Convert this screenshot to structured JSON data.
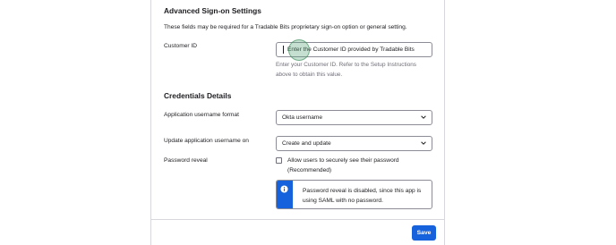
{
  "advanced": {
    "title": "Advanced Sign-on Settings",
    "description": "These fields may be required for a Tradable Bits proprietary sign-on option or general setting.",
    "customer_id": {
      "label": "Customer ID",
      "value": "",
      "placeholder": "Enter the Customer ID provided by Tradable Bits",
      "help": "Enter your Customer ID. Refer to the Setup Instructions above to obtain this value."
    }
  },
  "credentials": {
    "title": "Credentials Details",
    "username_format": {
      "label": "Application username format",
      "value": "Okta username"
    },
    "update_username": {
      "label": "Update application username on",
      "value": "Create and update"
    },
    "password_reveal": {
      "label": "Password reveal",
      "checkbox_label": "Allow users to securely see their password (Recommended)",
      "checked": false,
      "info": "Password reveal is disabled, since this app is using SAML with no password."
    }
  },
  "footer": {
    "save_label": "Save"
  },
  "colors": {
    "accent": "#1662dd"
  },
  "icons": {
    "dropdown": "chevron-down-icon",
    "info": "info-icon"
  }
}
